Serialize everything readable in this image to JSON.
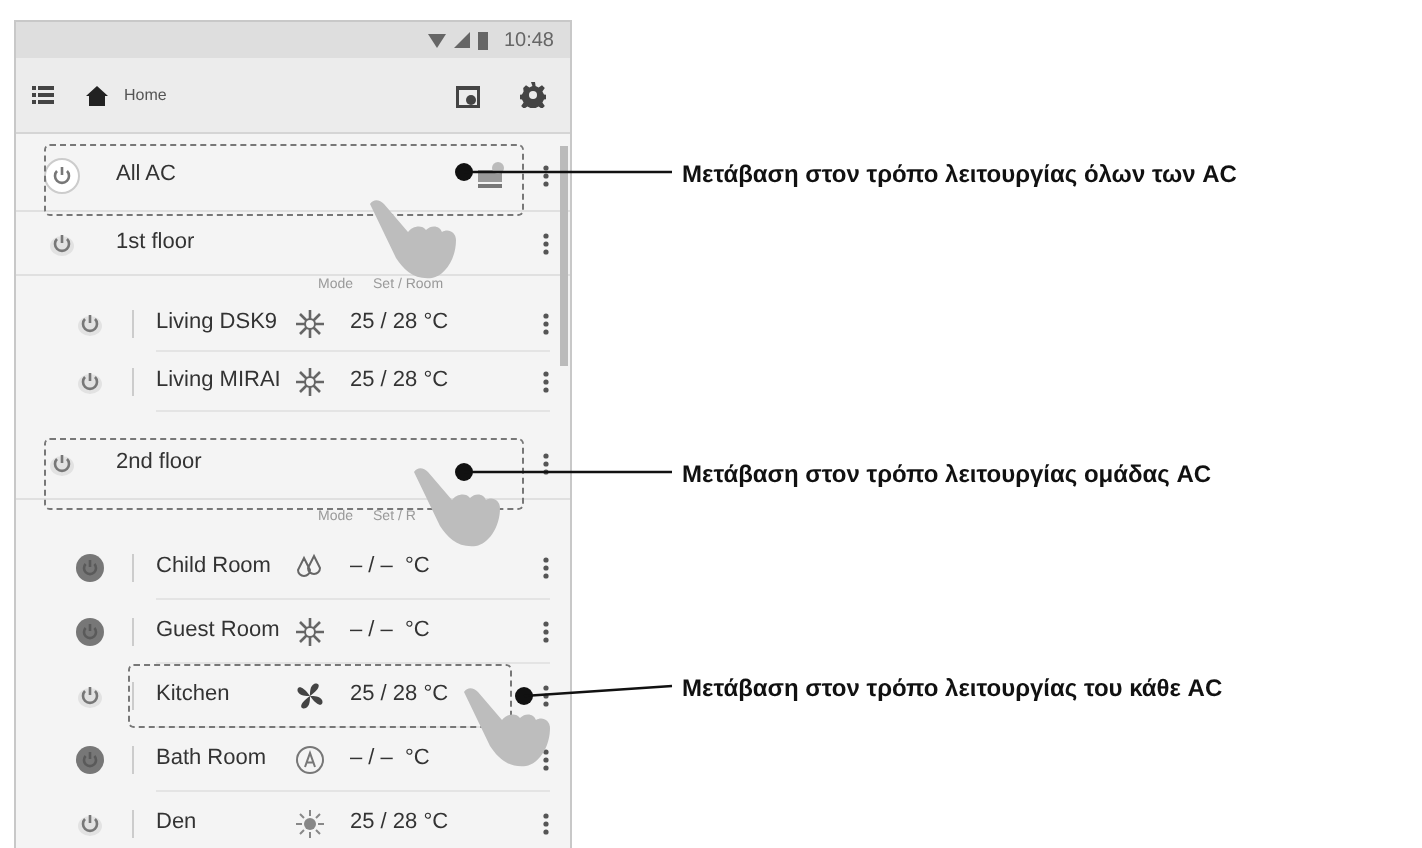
{
  "status_bar": {
    "time": "10:48"
  },
  "header": {
    "title": "Home"
  },
  "list": [
    {
      "kind": "all",
      "name": "All AC",
      "power_on": true
    },
    {
      "kind": "group",
      "name": "1st floor",
      "power_on": true,
      "columns": [
        "Mode",
        "Set / Room"
      ],
      "units": [
        {
          "name": "Living DSK9",
          "power_on": true,
          "kind": "cool",
          "temp": "25 / 28 °C"
        },
        {
          "name": "Living MIRAI",
          "power_on": true,
          "kind": "cool",
          "temp": "25 / 28 °C"
        }
      ]
    },
    {
      "kind": "group",
      "name": "2nd floor",
      "power_on": true,
      "columns": [
        "Mode",
        "Set / R"
      ],
      "units": [
        {
          "name": "Child Room",
          "power_on": false,
          "kind": "dry",
          "temp": "– / –  °C"
        },
        {
          "name": "Guest Room",
          "power_on": false,
          "kind": "cool",
          "temp": "– / –  °C"
        },
        {
          "name": "Kitchen",
          "power_on": true,
          "kind": "fan",
          "temp": "25 / 28 °C"
        },
        {
          "name": "Bath Room",
          "power_on": false,
          "kind": "auto",
          "temp": "– / –  °C"
        },
        {
          "name": "Den",
          "power_on": true,
          "kind": "heat",
          "temp": "25 / 28 °C"
        }
      ]
    }
  ],
  "callouts": [
    {
      "text": "Μετάβαση στον τρόπο λειτουργίας όλων των AC"
    },
    {
      "text": "Μετάβαση στον τρόπο λειτουργίας ομάδας AC"
    },
    {
      "text": "Μετάβαση στον τρόπο λειτουργίας του κάθε AC"
    }
  ]
}
